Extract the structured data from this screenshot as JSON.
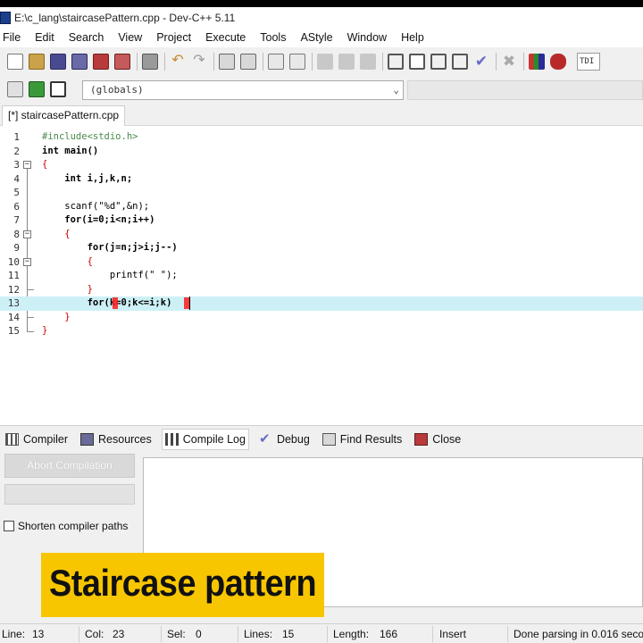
{
  "window": {
    "title": "E:\\c_lang\\staircasePattern.cpp - Dev-C++ 5.11"
  },
  "menu": [
    "File",
    "Edit",
    "Search",
    "View",
    "Project",
    "Execute",
    "Tools",
    "AStyle",
    "Window",
    "Help"
  ],
  "toolbar": {
    "tdm_label": "TDI"
  },
  "scope_select": {
    "value": "(globals)"
  },
  "editor_tab": {
    "label": "[*] staircasePattern.cpp"
  },
  "code_lines": [
    "#include<stdio.h>",
    "int main()",
    "{",
    "    int i,j,k,n;",
    "",
    "    scanf(\"%d\",&n);",
    "    for(i=0;i<n;i++)",
    "    {",
    "        for(j=n;j>i;j--)",
    "        {",
    "            printf(\" \");",
    "        }",
    "        for(k=0;k<=i;k)",
    "    }",
    "}"
  ],
  "current_line": 13,
  "bottom_tabs": [
    {
      "label": "Compiler",
      "icon": "grid-icon"
    },
    {
      "label": "Resources",
      "icon": "resources-icon"
    },
    {
      "label": "Compile Log",
      "icon": "chart-icon"
    },
    {
      "label": "Debug",
      "icon": "check-icon"
    },
    {
      "label": "Find Results",
      "icon": "find-icon"
    },
    {
      "label": "Close",
      "icon": "close-doc-icon"
    }
  ],
  "compiler_panel": {
    "abort_label": "Abort Compilation",
    "shorten_label": "Shorten compiler paths",
    "shorten_checked": false
  },
  "caption": {
    "text": "Staircase pattern"
  },
  "status": {
    "line_label": "Line:",
    "line": "13",
    "col_label": "Col:",
    "col": "23",
    "sel_label": "Sel:",
    "sel": "0",
    "lines_label": "Lines:",
    "lines": "15",
    "length_label": "Length:",
    "length": "166",
    "mode": "Insert",
    "message": "Done parsing in 0.016 seco"
  },
  "colors": {
    "current_line": "#cdf0f7",
    "caption_bg": "#f7c600",
    "bracket_highlight": "#ff1a1a"
  }
}
